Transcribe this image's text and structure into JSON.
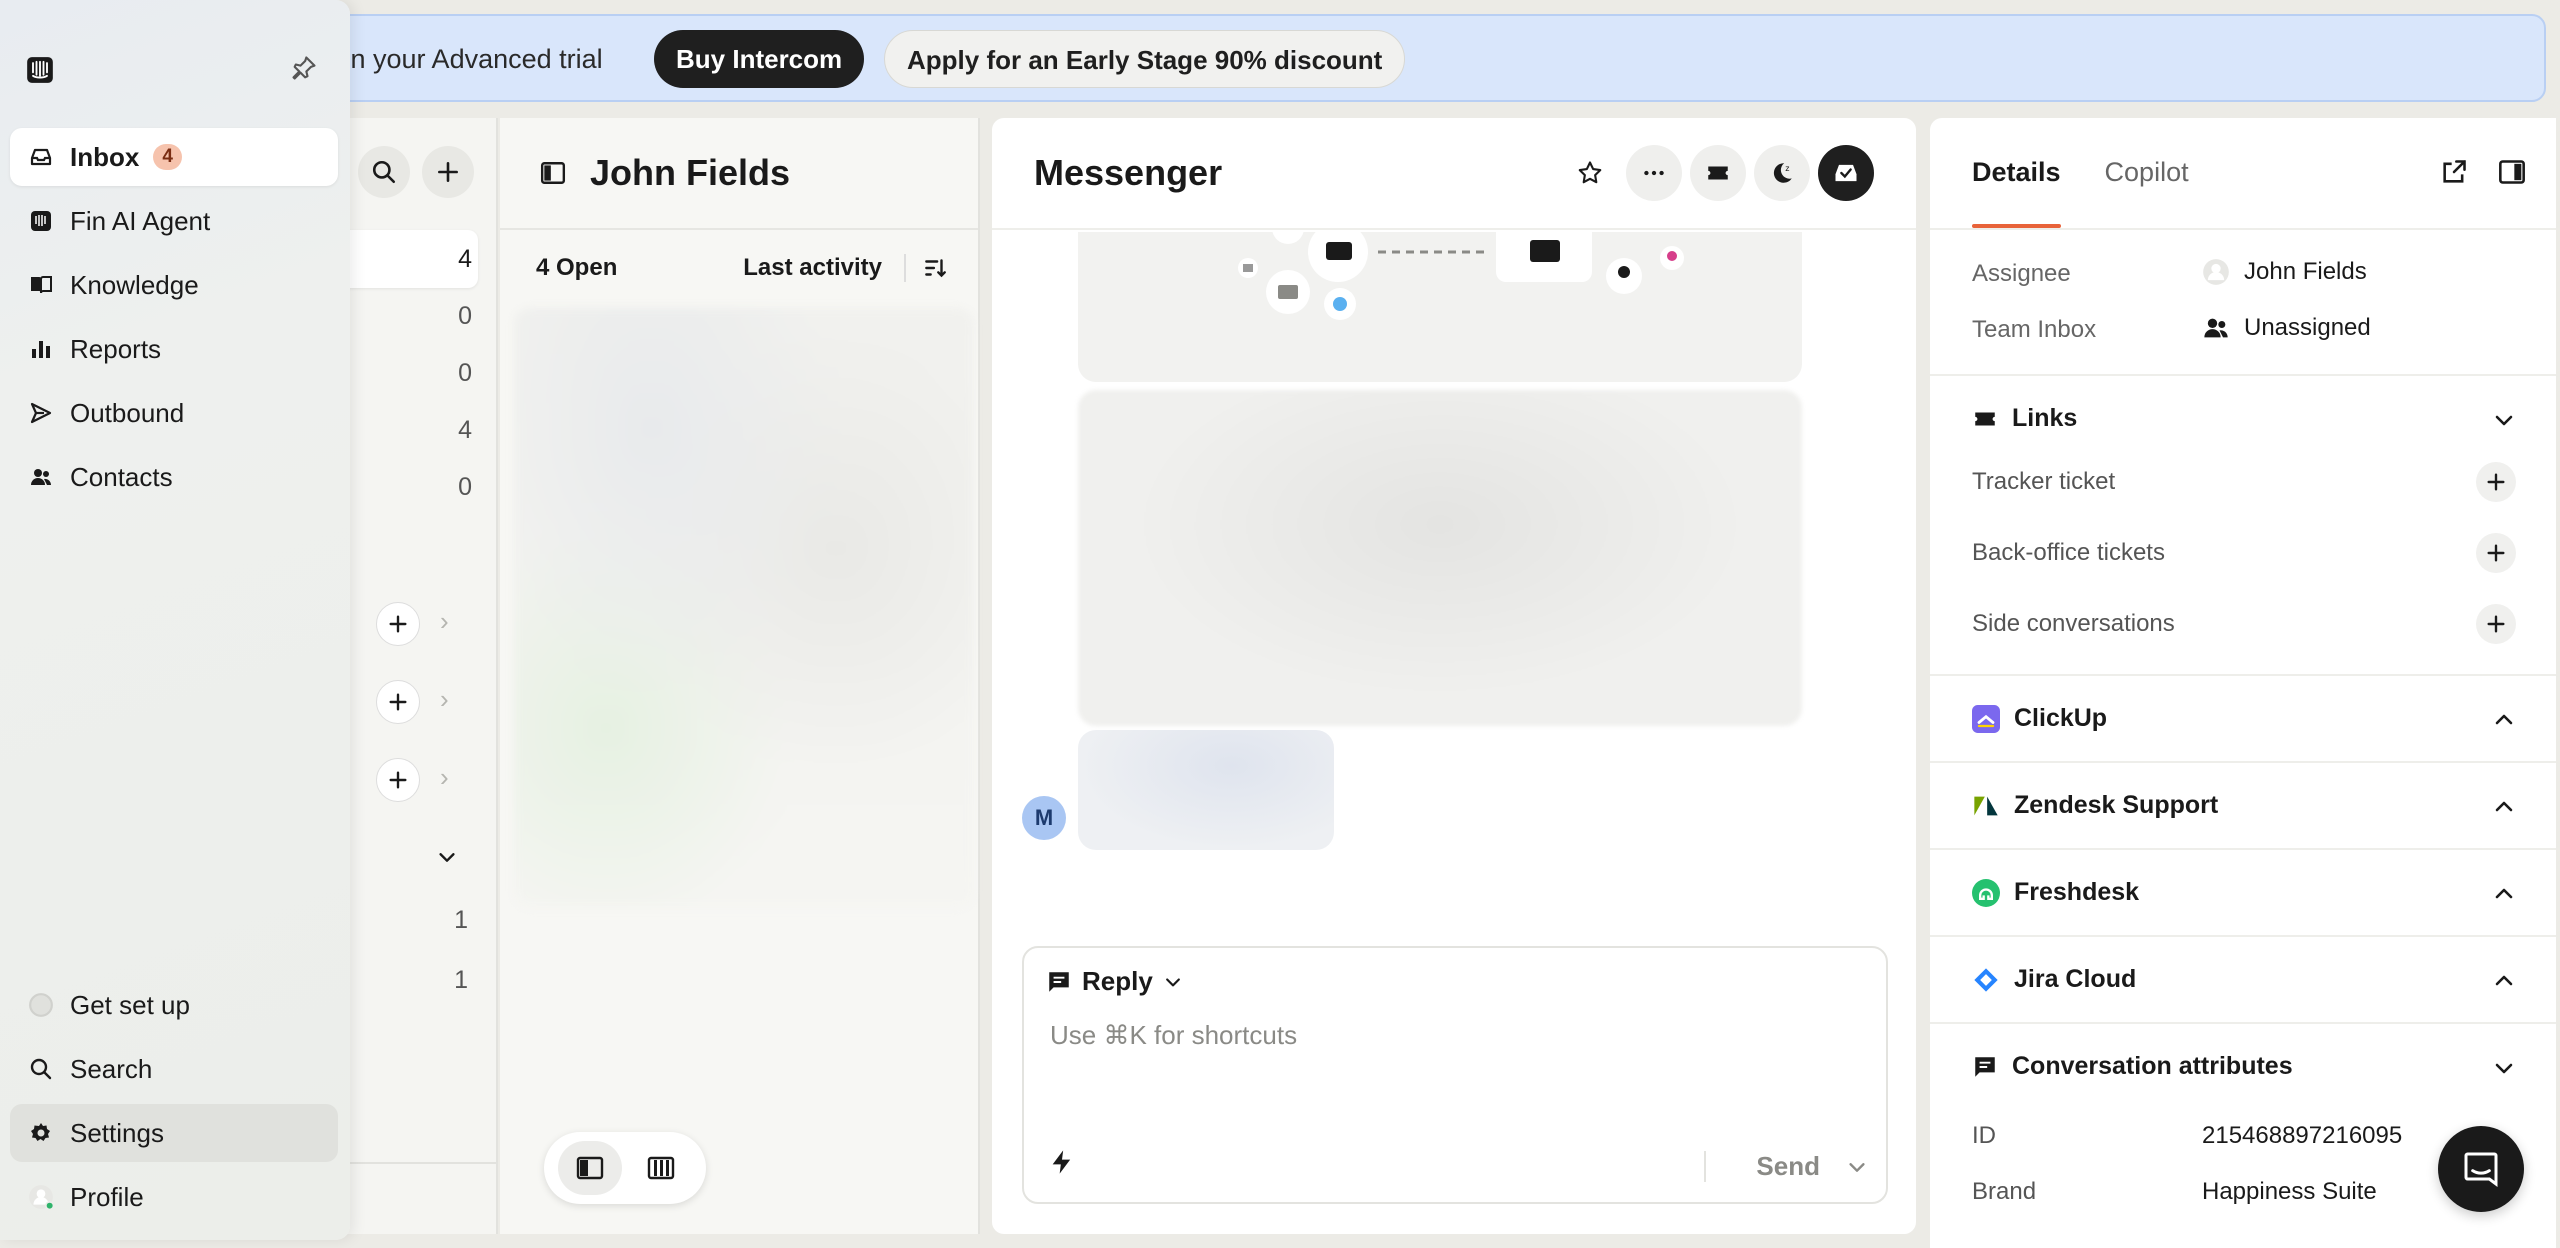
{
  "banner": {
    "text": "ft in your Advanced trial",
    "buy_label": "Buy Intercom",
    "discount_label": "Apply for an Early Stage 90% discount"
  },
  "nav": {
    "items": [
      {
        "label": "Inbox",
        "badge": "4",
        "icon": "inbox-icon"
      },
      {
        "label": "Fin AI Agent",
        "icon": "fin-icon"
      },
      {
        "label": "Knowledge",
        "icon": "book-icon"
      },
      {
        "label": "Reports",
        "icon": "bar-chart-icon"
      },
      {
        "label": "Outbound",
        "icon": "send-icon"
      },
      {
        "label": "Contacts",
        "icon": "people-icon"
      }
    ],
    "bottom": [
      {
        "label": "Get set up",
        "icon": "progress-icon"
      },
      {
        "label": "Search",
        "icon": "search-icon"
      },
      {
        "label": "Settings",
        "icon": "gear-icon"
      },
      {
        "label": "Profile",
        "icon": "avatar"
      }
    ]
  },
  "list": {
    "counts": [
      "4",
      "0",
      "0",
      "4",
      "0"
    ],
    "lower_counts": [
      "1",
      "1"
    ]
  },
  "inbox": {
    "title": "John Fields",
    "open_label": "4 Open",
    "sort_label": "Last activity"
  },
  "messenger": {
    "title": "Messenger",
    "avatar_initial": "M",
    "reply_label": "Reply",
    "composer_placeholder": "Use ⌘K for shortcuts",
    "send_label": "Send"
  },
  "details": {
    "tabs": [
      "Details",
      "Copilot"
    ],
    "assignee_label": "Assignee",
    "assignee_value": "John Fields",
    "team_label": "Team Inbox",
    "team_value": "Unassigned",
    "links_title": "Links",
    "links": [
      "Tracker ticket",
      "Back-office tickets",
      "Side conversations"
    ],
    "integrations": [
      "ClickUp",
      "Zendesk Support",
      "Freshdesk",
      "Jira Cloud"
    ],
    "attributes_title": "Conversation attributes",
    "id_label": "ID",
    "id_value": "215468897216095",
    "brand_label": "Brand",
    "brand_value": "Happiness Suite"
  },
  "colors": {
    "accent": "#e8633a",
    "banner_bg": "#d9e6fb",
    "clickup": "#7b68ee",
    "zendesk": "#03363d",
    "freshdesk": "#25c16f",
    "jira": "#2684ff"
  }
}
